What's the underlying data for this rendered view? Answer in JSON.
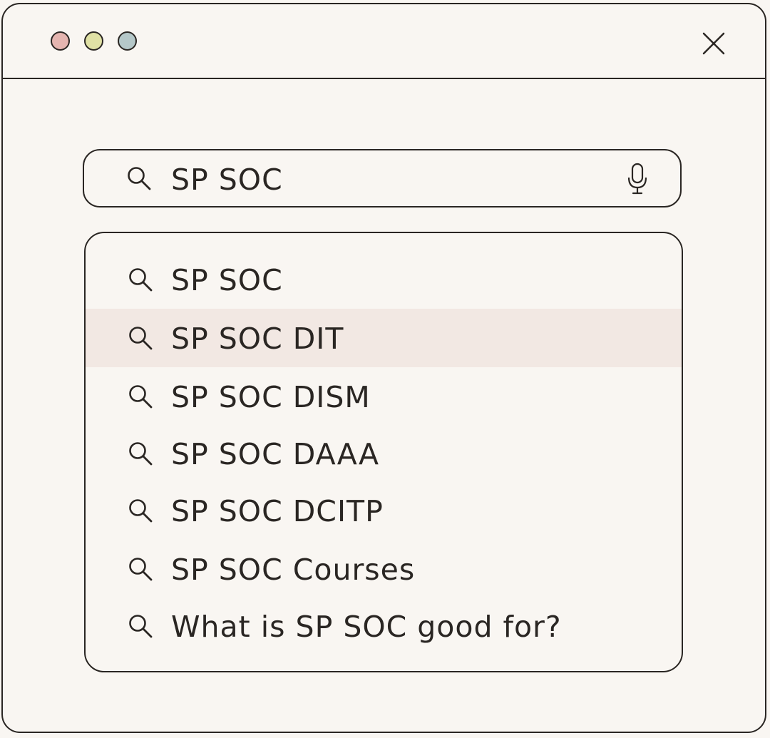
{
  "window": {
    "traffic_lights": [
      {
        "name": "red",
        "color": "#e5b5b0"
      },
      {
        "name": "yellow",
        "color": "#e0e1a5"
      },
      {
        "name": "blue",
        "color": "#b5c8c9"
      }
    ],
    "close_icon": "close-icon"
  },
  "search": {
    "query": "SP SOC",
    "icon": "search-icon",
    "mic_icon": "microphone-icon"
  },
  "suggestions": {
    "highlight_color": "#f2e8e3",
    "highlighted_index": 1,
    "items": [
      {
        "label": "SP SOC"
      },
      {
        "label": "SP SOC DIT"
      },
      {
        "label": "SP SOC DISM"
      },
      {
        "label": "SP SOC DAAA"
      },
      {
        "label": "SP SOC DCITP"
      },
      {
        "label": "SP SOC Courses"
      },
      {
        "label": "What is SP SOC good for?"
      }
    ]
  }
}
